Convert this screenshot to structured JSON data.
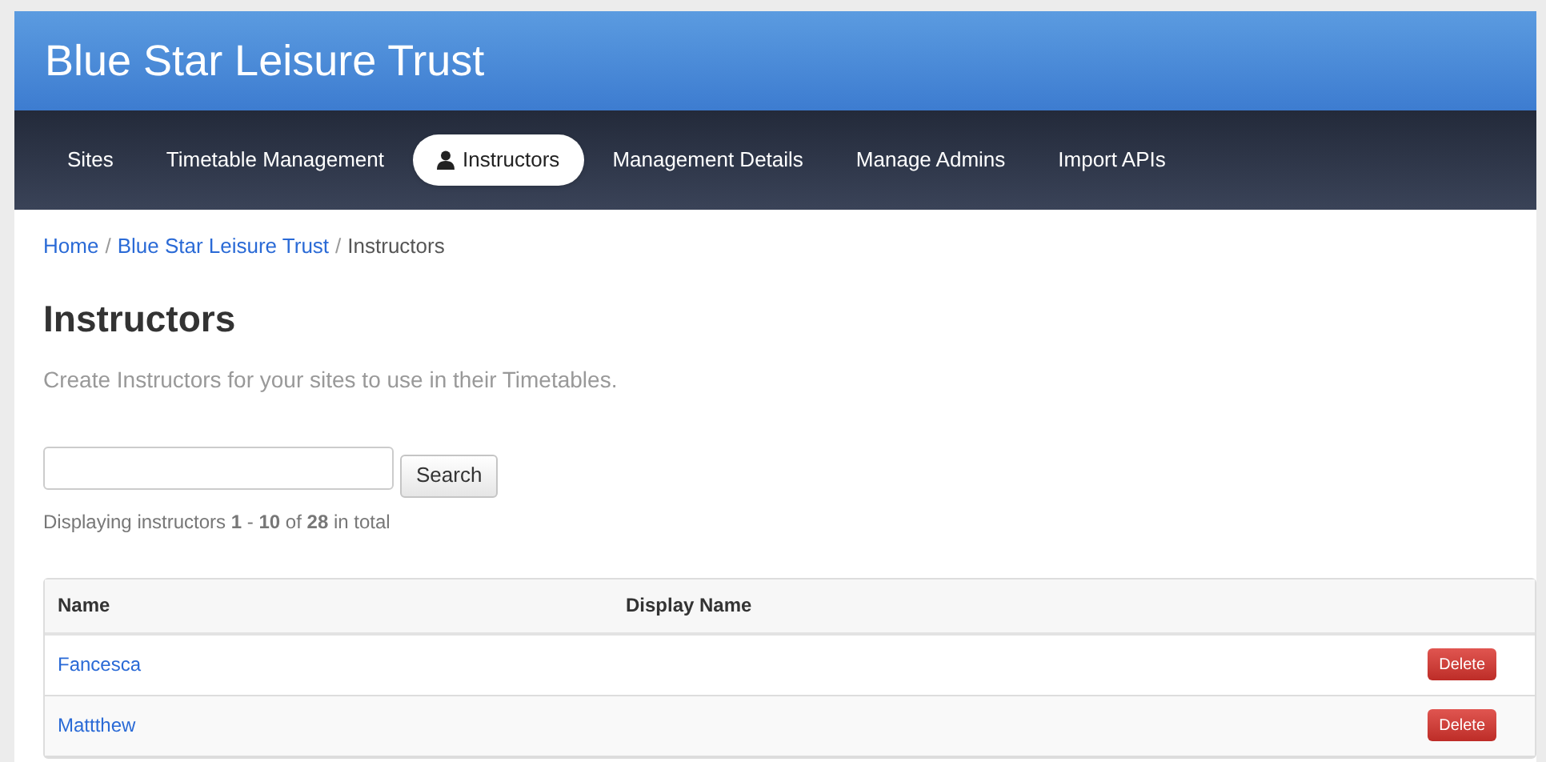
{
  "header": {
    "title": "Blue Star Leisure Trust"
  },
  "nav": [
    {
      "label": "Sites",
      "selected": false
    },
    {
      "label": "Timetable Management",
      "selected": false
    },
    {
      "label": "Instructors",
      "selected": true
    },
    {
      "label": "Management Details",
      "selected": false
    },
    {
      "label": "Manage Admins",
      "selected": false
    },
    {
      "label": "Import APIs",
      "selected": false
    }
  ],
  "breadcrumb": {
    "links": [
      "Home",
      "Blue Star Leisure Trust"
    ],
    "current": "Instructors",
    "separator": "/"
  },
  "page": {
    "title": "Instructors",
    "subtitle": "Create Instructors for your sites to use in their Timetables."
  },
  "search": {
    "button": "Search"
  },
  "summary": "Displaying instructors **1** - **10** of **28** in total",
  "table": {
    "columns": [
      "Name",
      "Display Name"
    ],
    "rows": [
      {
        "name": "Fancesca",
        "action": "Delete"
      },
      {
        "name": "Mattthew",
        "action": "Delete"
      }
    ]
  }
}
